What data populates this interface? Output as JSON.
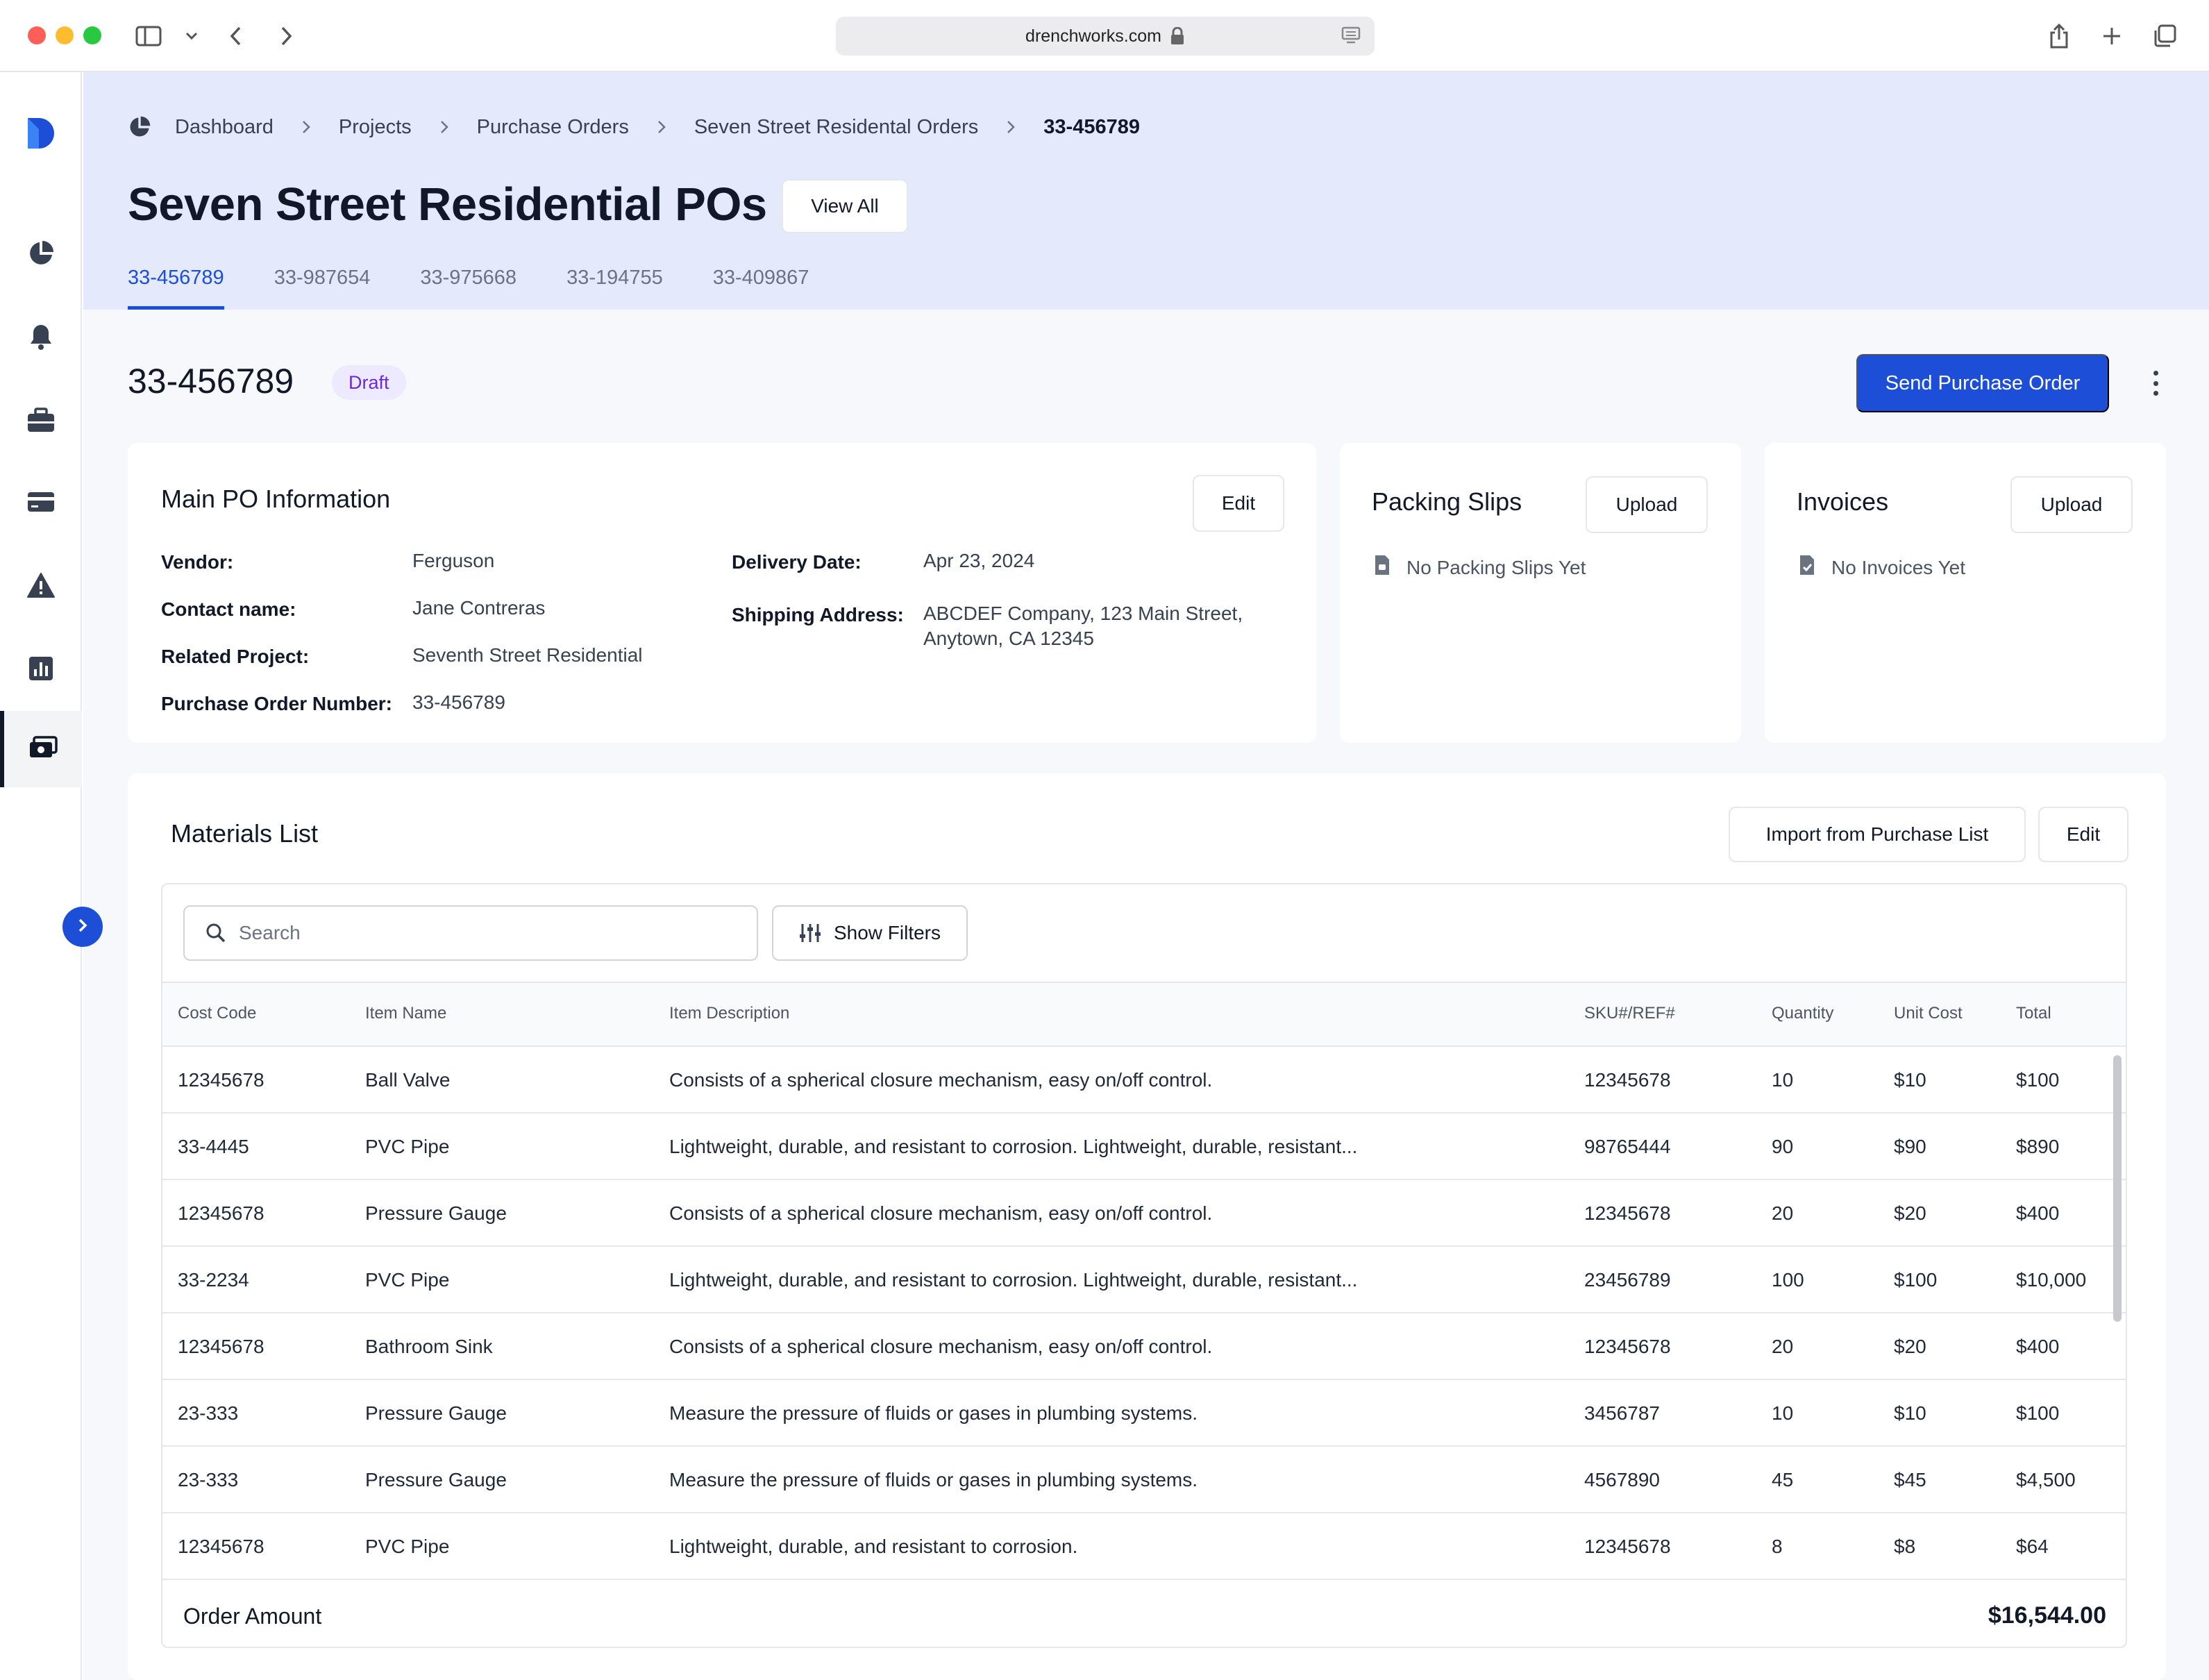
{
  "browser": {
    "url": "drenchworks.com"
  },
  "colors": {
    "primary": "#1d4ed8",
    "header_bg": "#e4e9fb",
    "draft_badge_bg": "#ede9fe",
    "draft_badge_text": "#6d28d9"
  },
  "sidebar": {
    "logo": "drenchworks-logo",
    "items": [
      {
        "icon": "pie-chart-icon"
      },
      {
        "icon": "bell-icon"
      },
      {
        "icon": "briefcase-icon"
      },
      {
        "icon": "credit-card-icon"
      },
      {
        "icon": "warning-icon"
      },
      {
        "icon": "bar-chart-icon"
      },
      {
        "icon": "money-icon",
        "active": true
      }
    ]
  },
  "breadcrumb": [
    "Dashboard",
    "Projects",
    "Purchase Orders",
    "Seven Street Residental Orders",
    "33-456789"
  ],
  "header": {
    "title": "Seven Street Residential POs",
    "view_all_label": "View All",
    "tabs": [
      "33-456789",
      "33-987654",
      "33-975668",
      "33-194755",
      "33-409867"
    ],
    "active_tab": "33-456789"
  },
  "po": {
    "number": "33-456789",
    "status": "Draft",
    "send_label": "Send Purchase Order"
  },
  "main_info": {
    "title": "Main PO Information",
    "edit_label": "Edit",
    "fields_left": [
      {
        "label": "Vendor:",
        "value": "Ferguson"
      },
      {
        "label": "Contact name:",
        "value": "Jane Contreras"
      },
      {
        "label": "Related Project:",
        "value": "Seventh Street Residential"
      },
      {
        "label": "Purchase Order Number:",
        "value": "33-456789"
      }
    ],
    "fields_right": [
      {
        "label": "Delivery Date:",
        "value": "Apr 23, 2024"
      },
      {
        "label": "Shipping Address:",
        "value_line1": "ABCDEF Company, 123 Main Street,",
        "value_line2": "Anytown, CA 12345"
      }
    ]
  },
  "packing_slips": {
    "title": "Packing Slips",
    "upload_label": "Upload",
    "empty": "No Packing Slips Yet"
  },
  "invoices": {
    "title": "Invoices",
    "upload_label": "Upload",
    "empty": "No Invoices Yet"
  },
  "materials": {
    "title": "Materials List",
    "import_label": "Import from Purchase  List",
    "edit_label": "Edit",
    "search_placeholder": "Search",
    "filters_label": "Show Filters",
    "columns": [
      "Cost Code",
      "Item Name",
      "Item Description",
      "SKU#/REF#",
      "Quantity",
      "Unit Cost",
      "Total"
    ],
    "rows": [
      {
        "cost_code": "12345678",
        "item": "Ball Valve",
        "desc": "Consists of a spherical closure mechanism, easy on/off control.",
        "sku": "12345678",
        "qty": "10",
        "unit": "$10",
        "total": "$100"
      },
      {
        "cost_code": "33-4445",
        "item": "PVC Pipe",
        "desc": "Lightweight, durable, and resistant to corrosion. Lightweight, durable, resistant...",
        "sku": "98765444",
        "qty": "90",
        "unit": "$90",
        "total": "$890"
      },
      {
        "cost_code": "12345678",
        "item": "Pressure Gauge",
        "desc": "Consists of a spherical closure mechanism, easy on/off control.",
        "sku": "12345678",
        "qty": "20",
        "unit": "$20",
        "total": "$400"
      },
      {
        "cost_code": "33-2234",
        "item": "PVC Pipe",
        "desc": "Lightweight, durable, and resistant to corrosion. Lightweight, durable, resistant...",
        "sku": "23456789",
        "qty": "100",
        "unit": "$100",
        "total": "$10,000"
      },
      {
        "cost_code": "12345678",
        "item": "Bathroom Sink",
        "desc": "Consists of a spherical closure mechanism, easy on/off control.",
        "sku": "12345678",
        "qty": "20",
        "unit": "$20",
        "total": "$400"
      },
      {
        "cost_code": "23-333",
        "item": "Pressure Gauge",
        "desc": "Measure the pressure of fluids or gases in plumbing systems.",
        "sku": "3456787",
        "qty": "10",
        "unit": "$10",
        "total": "$100"
      },
      {
        "cost_code": "23-333",
        "item": "Pressure Gauge",
        "desc": "Measure the pressure of fluids or gases in plumbing systems.",
        "sku": "4567890",
        "qty": "45",
        "unit": "$45",
        "total": "$4,500"
      },
      {
        "cost_code": "12345678",
        "item": "PVC Pipe",
        "desc": "Lightweight, durable, and resistant to corrosion.",
        "sku": "12345678",
        "qty": "8",
        "unit": "$8",
        "total": "$64"
      }
    ],
    "order_amount_label": "Order Amount",
    "order_amount": "$16,544.00"
  }
}
